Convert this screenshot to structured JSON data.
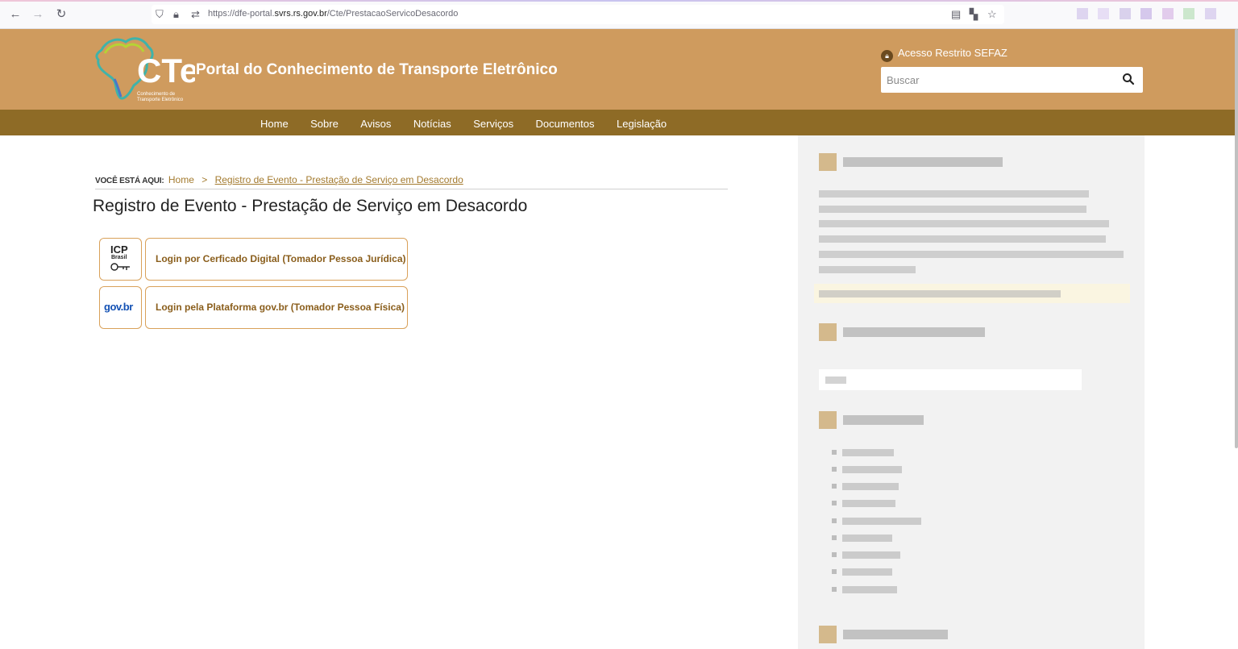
{
  "browser": {
    "url_prefix": "https://dfe-portal.",
    "url_domain": "svrs.rs.gov.br",
    "url_path": "/Cte/PrestacaoServicoDesacordo"
  },
  "header": {
    "logo_text": "CTe",
    "logo_sub": "Conhecimento de Transporte Eletrônico",
    "title": "Portal do Conhecimento de Transporte Eletrônico",
    "restricted_label": "Acesso Restrito SEFAZ",
    "search_placeholder": "Buscar"
  },
  "nav": {
    "items": [
      "Home",
      "Sobre",
      "Avisos",
      "Notícias",
      "Serviços",
      "Documentos",
      "Legislação"
    ]
  },
  "breadcrumb": {
    "label": "VOCÊ ESTÁ AQUI:",
    "home": "Home",
    "separator": ">",
    "current": "Registro de Evento - Prestação de Serviço em Desacordo"
  },
  "page": {
    "title": "Registro de Evento - Prestação de Serviço em Desacordo"
  },
  "login": {
    "icp_label_1": "ICP",
    "icp_label_2": "Brasil",
    "icp_button": "Login por Cerficado Digital (Tomador Pessoa Jurídica)",
    "govbr_label": "gov.br",
    "govbr_button": "Login pela Plataforma gov.br (Tomador Pessoa Física)"
  },
  "colors": {
    "header_bg": "#cf9b5e",
    "nav_bg": "#8e6b26",
    "accent": "#a37a2e",
    "button_border": "#d9a15a"
  }
}
